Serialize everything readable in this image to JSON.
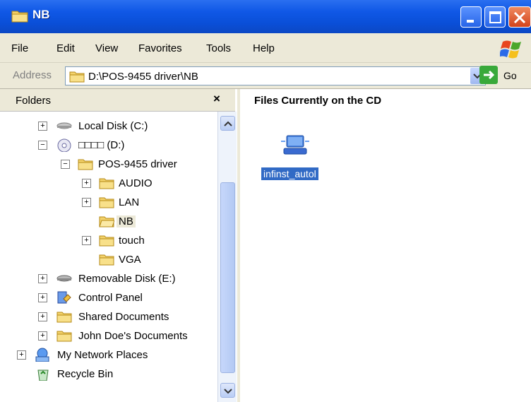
{
  "window": {
    "title": "NB",
    "icon": "folder-icon",
    "buttons": [
      "minimize-icon",
      "maximize-icon",
      "close-icon"
    ]
  },
  "menu": {
    "items": [
      "File",
      "Edit",
      "View",
      "Favorites",
      "Tools",
      "Help"
    ]
  },
  "address": {
    "label": "Address",
    "path": "D:\\POS-9455 driver\\NB",
    "go_label": "Go"
  },
  "folders_pane": {
    "title": "Folders",
    "close_label": "×",
    "tree": [
      {
        "label": "Local Disk (C:)",
        "icon": "hard-disk-icon",
        "expander": "+"
      },
      {
        "label": "□□□□ (D:)",
        "icon": "cd-drive-icon",
        "expander": "−"
      },
      {
        "label": "POS-9455 driver",
        "icon": "folder-icon",
        "expander": "−"
      },
      {
        "label": "AUDIO",
        "icon": "folder-icon",
        "expander": "+"
      },
      {
        "label": "LAN",
        "icon": "folder-icon",
        "expander": "+"
      },
      {
        "label": "NB",
        "icon": "open-folder-icon",
        "expander": "",
        "selected": true
      },
      {
        "label": "touch",
        "icon": "folder-icon",
        "expander": "+"
      },
      {
        "label": "VGA",
        "icon": "folder-icon",
        "expander": ""
      },
      {
        "label": "Removable Disk (E:)",
        "icon": "removable-disk-icon",
        "expander": "+"
      },
      {
        "label": "Control Panel",
        "icon": "control-panel-icon",
        "expander": "+"
      },
      {
        "label": "Shared Documents",
        "icon": "folder-icon",
        "expander": "+"
      },
      {
        "label": "John Doe's Documents",
        "icon": "folder-icon",
        "expander": "+"
      },
      {
        "label": "My Network Places",
        "icon": "network-icon",
        "expander": "+"
      },
      {
        "label": "Recycle Bin",
        "icon": "recycle-bin-icon",
        "expander": ""
      }
    ]
  },
  "files_pane": {
    "title": "Files Currently on the CD",
    "files": [
      {
        "name": "infinst_autol",
        "icon": "setup-file-icon",
        "selected": true
      }
    ]
  },
  "colors": {
    "titlebar": "#0a4fd8",
    "selection": "#316ac5",
    "chrome": "#ece9d8"
  }
}
